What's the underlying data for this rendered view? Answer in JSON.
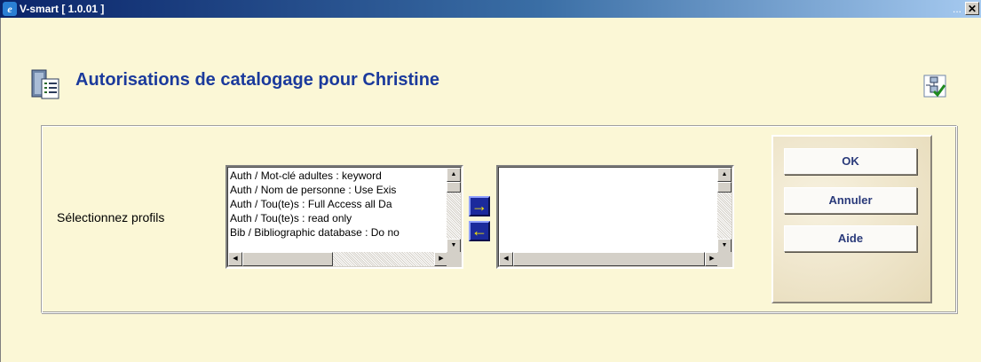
{
  "window": {
    "title": "V-smart [ 1.0.01 ]",
    "ellipsis": "...",
    "close_glyph": "✕"
  },
  "page": {
    "title": "Autorisations de catalogage pour Christine"
  },
  "form": {
    "field_label": "Sélectionnez profils",
    "available_profiles": [
      "Auth / Mot-clé adultes : keyword",
      "Auth / Nom de personne : Use Exis",
      "Auth / Tou(te)s : Full Access all Da",
      "Auth / Tou(te)s : read only",
      "Bib / Bibliographic database : Do no"
    ],
    "selected_profiles": [],
    "add_arrow": "→",
    "remove_arrow": "←"
  },
  "buttons": {
    "ok": "OK",
    "cancel": "Annuler",
    "help": "Aide"
  },
  "colors": {
    "background": "#fbf7d6",
    "title_blue": "#1b3a9c",
    "arrow_button": "#1b2a9c",
    "arrow_glyph": "#ffe900"
  },
  "icons": {
    "page_icon": "document-list-icon",
    "top_right_icon": "checkmark-flow-icon",
    "app_icon": "ie-icon"
  }
}
